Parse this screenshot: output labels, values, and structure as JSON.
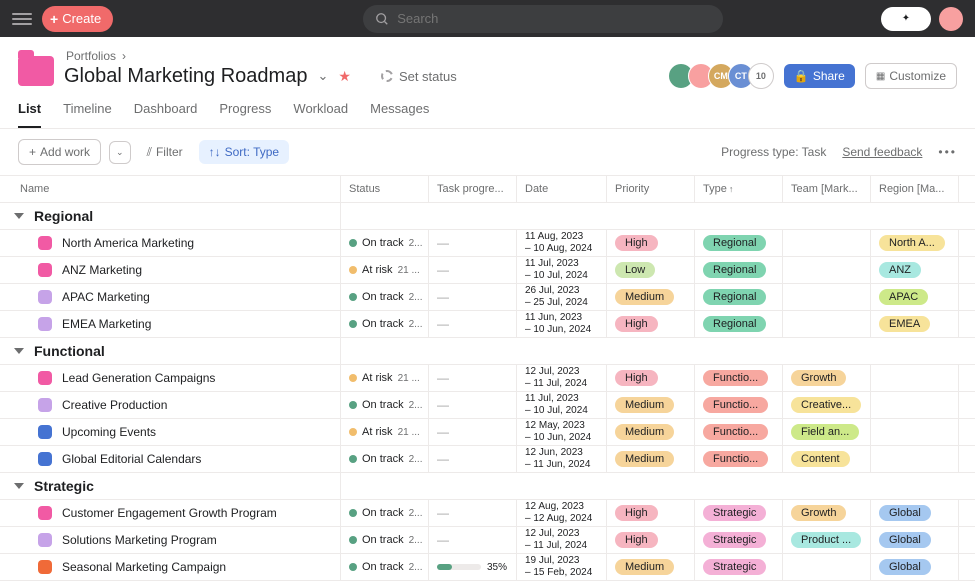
{
  "topbar": {
    "create": "Create",
    "search_placeholder": "Search"
  },
  "breadcrumb": {
    "portfolios": "Portfolios"
  },
  "header": {
    "title": "Global Marketing Roadmap",
    "set_status": "Set status",
    "share": "Share",
    "customize": "Customize",
    "avatar_count": "10",
    "av3": "CM",
    "av4": "CT"
  },
  "tabs": {
    "list": "List",
    "timeline": "Timeline",
    "dashboard": "Dashboard",
    "progress": "Progress",
    "workload": "Workload",
    "messages": "Messages"
  },
  "toolbar": {
    "add_work": "Add work",
    "filter": "Filter",
    "sort": "Sort: Type",
    "progress_type": "Progress type: Task",
    "feedback": "Send feedback"
  },
  "columns": {
    "name": "Name",
    "status": "Status",
    "task_progress": "Task progre...",
    "date": "Date",
    "priority": "Priority",
    "type": "Type",
    "team": "Team [Mark...",
    "region": "Region [Ma..."
  },
  "status_labels": {
    "on_track": "On track",
    "at_risk": "At risk"
  },
  "groups": [
    {
      "name": "Regional",
      "rows": [
        {
          "name": "North America Marketing",
          "box": "#f15aa4",
          "status": "on_track",
          "count": "2...",
          "date1": "11 Aug, 2023",
          "date2": "– 10 Aug, 2024",
          "priority": "High",
          "pri_bg": "#f6b5c0",
          "type": "Regional",
          "type_bg": "#7fd4b0",
          "region": "North A...",
          "region_bg": "#f7e39a"
        },
        {
          "name": "ANZ Marketing",
          "box": "#f15aa4",
          "status": "at_risk",
          "count": "21 ...",
          "date1": "11 Jul, 2023",
          "date2": "– 10 Jul, 2024",
          "priority": "Low",
          "pri_bg": "#cde7b0",
          "type": "Regional",
          "type_bg": "#7fd4b0",
          "region": "ANZ",
          "region_bg": "#a8e8e0"
        },
        {
          "name": "APAC Marketing",
          "box": "#c6a3e8",
          "status": "on_track",
          "count": "2...",
          "date1": "26 Jul, 2023",
          "date2": "– 25 Jul, 2024",
          "priority": "Medium",
          "pri_bg": "#f6d49a",
          "type": "Regional",
          "type_bg": "#7fd4b0",
          "region": "APAC",
          "region_bg": "#cde989"
        },
        {
          "name": "EMEA Marketing",
          "box": "#c6a3e8",
          "status": "on_track",
          "count": "2...",
          "date1": "11 Jun, 2023",
          "date2": "– 10 Jun, 2024",
          "priority": "High",
          "pri_bg": "#f6b5c0",
          "type": "Regional",
          "type_bg": "#7fd4b0",
          "region": "EMEA",
          "region_bg": "#f7e39a"
        }
      ]
    },
    {
      "name": "Functional",
      "rows": [
        {
          "name": "Lead Generation Campaigns",
          "box": "#f15aa4",
          "status": "at_risk",
          "count": "21 ...",
          "date1": "12 Jul, 2023",
          "date2": "– 11 Jul, 2024",
          "priority": "High",
          "pri_bg": "#f6b5c0",
          "type": "Functio...",
          "type_bg": "#f7a8a0",
          "team": "Growth",
          "team_bg": "#f6d49a"
        },
        {
          "name": "Creative Production",
          "box": "#c6a3e8",
          "status": "on_track",
          "count": "2...",
          "date1": "11 Jul, 2023",
          "date2": "– 10 Jul, 2024",
          "priority": "Medium",
          "pri_bg": "#f6d49a",
          "type": "Functio...",
          "type_bg": "#f7a8a0",
          "team": "Creative...",
          "team_bg": "#f7e39a"
        },
        {
          "name": "Upcoming Events",
          "box": "#4573d2",
          "status": "at_risk",
          "count": "21 ...",
          "date1": "12 May, 2023",
          "date2": "– 10 Jun, 2024",
          "priority": "Medium",
          "pri_bg": "#f6d49a",
          "type": "Functio...",
          "type_bg": "#f7a8a0",
          "team": "Field an...",
          "team_bg": "#cde989"
        },
        {
          "name": "Global Editorial Calendars",
          "box": "#4573d2",
          "status": "on_track",
          "count": "2...",
          "date1": "12 Jun, 2023",
          "date2": "– 11 Jun, 2024",
          "priority": "Medium",
          "pri_bg": "#f6d49a",
          "type": "Functio...",
          "type_bg": "#f7a8a0",
          "team": "Content",
          "team_bg": "#f7e39a"
        }
      ]
    },
    {
      "name": "Strategic",
      "rows": [
        {
          "name": "Customer Engagement Growth Program",
          "box": "#f15aa4",
          "status": "on_track",
          "count": "2...",
          "date1": "12 Aug, 2023",
          "date2": "– 12 Aug, 2024",
          "priority": "High",
          "pri_bg": "#f6b5c0",
          "type": "Strategic",
          "type_bg": "#f4b0d6",
          "team": "Growth",
          "team_bg": "#f6d49a",
          "region": "Global",
          "region_bg": "#a5c8f0"
        },
        {
          "name": "Solutions Marketing Program",
          "box": "#c6a3e8",
          "status": "on_track",
          "count": "2...",
          "date1": "12 Jul, 2023",
          "date2": "– 11 Jul, 2024",
          "priority": "High",
          "pri_bg": "#f6b5c0",
          "type": "Strategic",
          "type_bg": "#f4b0d6",
          "team": "Product ...",
          "team_bg": "#a8e8e0",
          "region": "Global",
          "region_bg": "#a5c8f0"
        },
        {
          "name": "Seasonal Marketing Campaign",
          "box": "#f06a38",
          "status": "on_track",
          "count": "2...",
          "date1": "19 Jul, 2023",
          "date2": "– 15 Feb, 2024",
          "priority": "Medium",
          "pri_bg": "#f6d49a",
          "type": "Strategic",
          "type_bg": "#f4b0d6",
          "region": "Global",
          "region_bg": "#a5c8f0",
          "progress_pct": 35
        }
      ]
    }
  ]
}
